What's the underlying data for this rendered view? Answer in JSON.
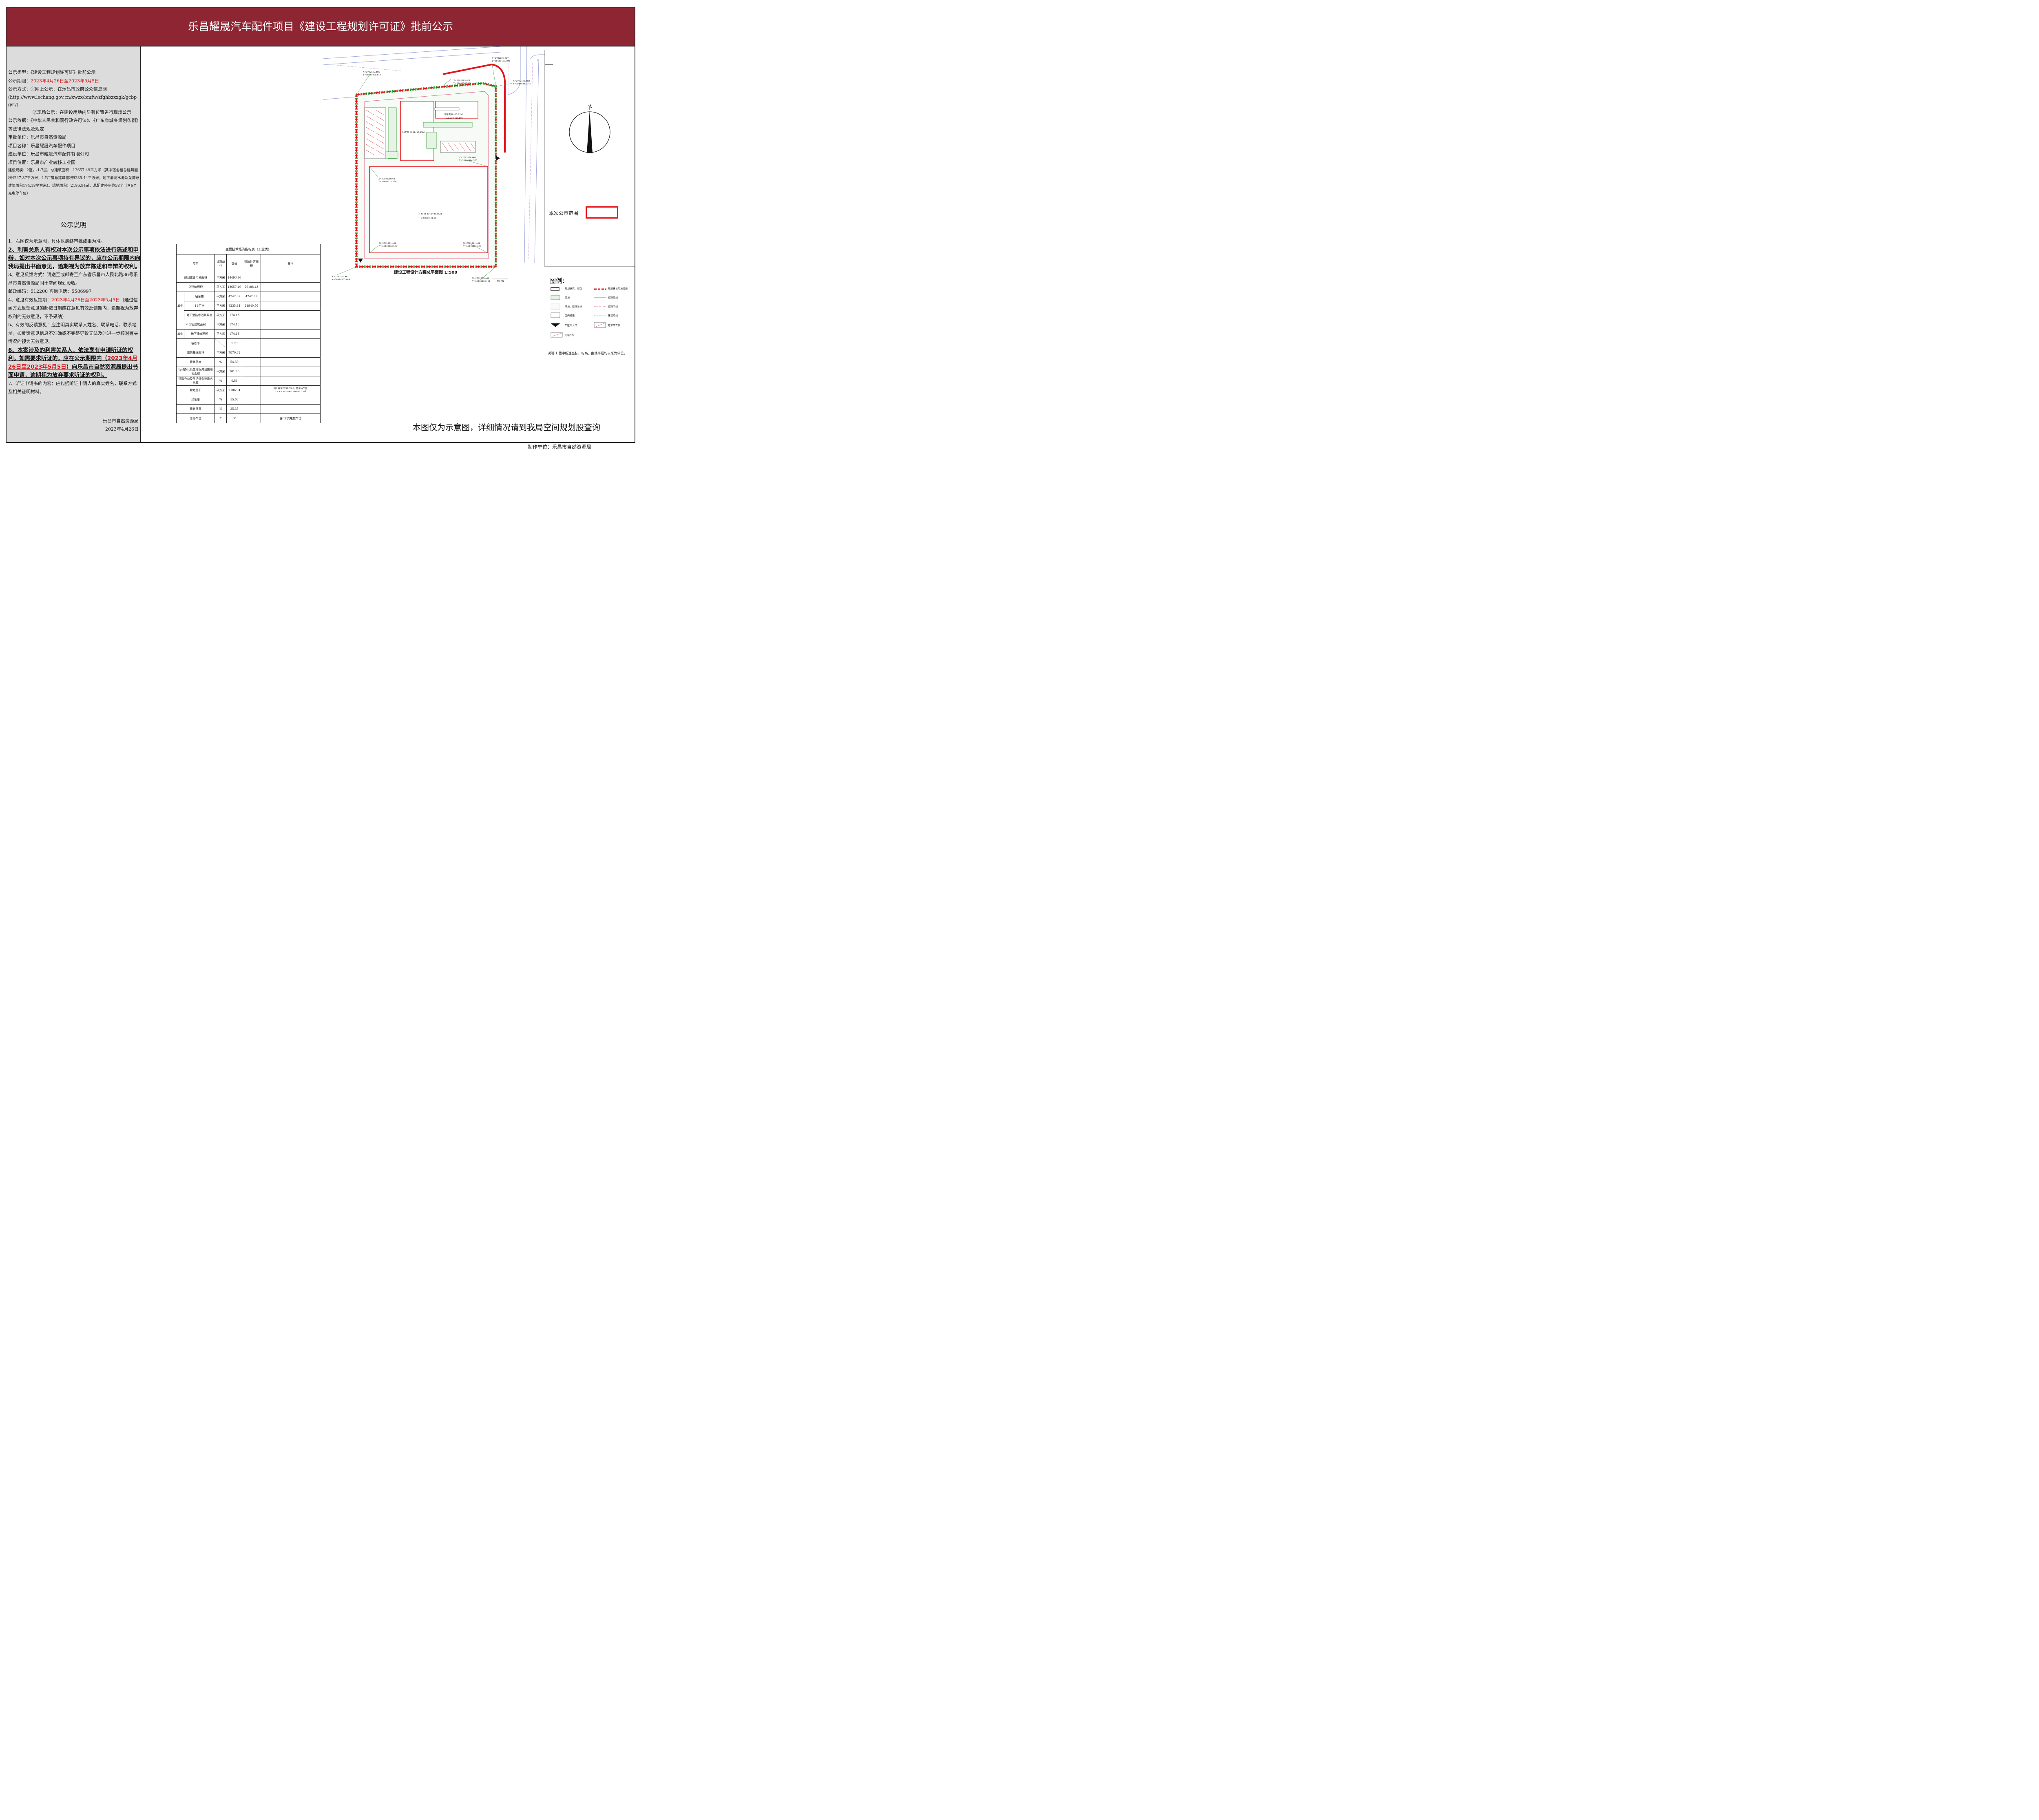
{
  "header": {
    "title": "乐昌耀晟汽车配件项目《建设工程规划许可证》批前公示"
  },
  "info": {
    "type": "公示类型：《建设工程规划许可证》批前公示",
    "period_label": "公示期限：",
    "period_value": "2023年4月26日至2023年5月5日",
    "method1": "公示方式：①网上公示：在乐昌市政府公众信息网",
    "method1_url": "(http://www.lechang.gov.cn/xwzx/bmfw/zfghbzxxgk/gcbpgst/)",
    "method2": "②现场公示：在建设用地内显著位置进行现场公示",
    "basis": "公示依据：《中华人民共和国行政许可法》、《广东省城乡规划条例》等法律法规及规定",
    "approver": "审批单位：乐昌市自然资源局",
    "project": "项目名称：乐昌耀晟汽车配件项目",
    "builder": "建设单位：乐昌市耀晟汽车配件有限公司",
    "location": "项目位置：乐昌市产业转移工业园",
    "scale": "建设规模：2座，-1-7层，总建筑面积：13657.49平方米（其中宿舍楼总建筑面积4247.87平方米；1#厂房总建筑面积9235.44平方米；地下消防水池及泵房总建筑面积174.18平方米）。绿地面积：2186.94㎡，总配建停车位58个（含6个充电停车位）"
  },
  "notes_title": "公示说明",
  "notes": {
    "n1": "1、右图仅为示意图，具体以最终审批成果为准。",
    "n2": "2、利害关系人有权对本次公示事项依法进行陈述和申辩，如对本次公示事项持有异议的，应在公示期限内向我局提出书面意见，逾期视为放弃陈述和申辩的权利。",
    "n3": "3、意见反馈方式：请送至或邮寄至广东省乐昌市人民北路36号乐昌市自然资源局国土空间规划股收。",
    "n3b": "邮政编码：512200 咨询电话：5586997",
    "n4_pre": "4、意见有效反馈期：",
    "n4_red": "2023年4月26日至2023年5月5日",
    "n4_post": "（通过信函方式反馈意见的邮戳日期应在意见有效反馈期内，逾期视为放弃权利的无效意见，不予采纳）",
    "n5": "5、有效的反馈意见：应注明真实联系人姓名、联系电话、联系地址，如反馈意见信息不准确或不完整导致无法及时进一步核对有关情况的视为无效意见。",
    "n6_pre": "6、本案涉及的利害关系人，依法享有申请听证的权利。如需要求听证的，应在公示期限内（",
    "n6_red": "2023年4月26日至2023年5月5日",
    "n6_post": "）向乐昌市自然资源局提出书面申请，逾期视为放弃要求听证的权利。",
    "n7": "7、听证申请书的内容：应包括听证申请人的真实姓名，联系方式及相关证明材料。"
  },
  "sign": {
    "org": "乐昌市自然资源局",
    "date": "2023年4月26日"
  },
  "table": {
    "title": "主要技术经济指标表（工业类）",
    "headers": [
      "项目",
      "计算单位",
      "数值",
      "建筑计容面积",
      "备注"
    ],
    "group1": "其中",
    "group2": "其中",
    "rows": [
      {
        "item": "规划建设用地面积",
        "unit": "平方米",
        "value": "14493.90",
        "far": "",
        "note": ""
      },
      {
        "item": "总建筑面积",
        "unit": "平方米",
        "value": "13657.49",
        "far": "26188.43",
        "note": ""
      },
      {
        "item": "宿舍楼",
        "unit": "平方米",
        "value": "4247.87",
        "far": "4247.87",
        "note": ""
      },
      {
        "item": "1#厂房",
        "unit": "平方米",
        "value": "9235.44",
        "far": "21940.56",
        "note": ""
      },
      {
        "item": "地下消防水池及泵房",
        "unit": "平方米",
        "value": "174.18",
        "far": "",
        "note": ""
      },
      {
        "item": "不计容建筑面积",
        "unit": "平方米",
        "value": "174.18",
        "far": "",
        "note": ""
      },
      {
        "item": "地下建筑面积",
        "unit": "平方米",
        "value": "174.18",
        "far": "",
        "note": ""
      },
      {
        "item": "容积率",
        "unit": "",
        "value": "1.79",
        "far": "",
        "note": ""
      },
      {
        "item": "建筑基底面积",
        "unit": "平方米",
        "value": "7870.83",
        "far": "",
        "note": ""
      },
      {
        "item": "建筑密度",
        "unit": "%",
        "value": "54.30",
        "far": "",
        "note": ""
      },
      {
        "item": "行政办公及生活服务设施用地面积",
        "unit": "平方米",
        "value": "701.68",
        "far": "",
        "note": ""
      },
      {
        "item": "行政办公及生活服务设施占地率",
        "unit": "%",
        "value": "4.84",
        "far": "",
        "note": ""
      },
      {
        "item": "绿地面积",
        "unit": "平方米",
        "value": "2186.94",
        "far": "",
        "note": "地上绿化2039.39㎡，植草砖车位2.4×5.3×58×0.2=147.55㎡"
      },
      {
        "item": "绿地率",
        "unit": "%",
        "value": "15.08",
        "far": "",
        "note": ""
      },
      {
        "item": "建筑限高",
        "unit": "米",
        "value": "25.35",
        "far": "",
        "note": ""
      },
      {
        "item": "总停车位",
        "unit": "个",
        "value": "58",
        "far": "",
        "note": "含6个充电桩车位"
      }
    ]
  },
  "plan": {
    "title": "建设工程设计方案总平面图 1:500",
    "north": "北",
    "scope_label": "本次公示范围",
    "factory_label": "1#厂房 1F  H=14.95M",
    "factory_elev": "±0.000[121.50]",
    "dorm_label": "1#厂房 L1 H=17.85M",
    "dorm_label2": "宿舍楼 H=25.35M",
    "dorm_elev": "±0.000[121.50]",
    "coords": {
      "c1": "X=2782682.495",
      "c1y": "Y=38440305.649",
      "c2": "X=2782683.861",
      "c2y": "Y=38440367.291",
      "c3": "X=2782693.627",
      "c3y": "Y=38440403.798",
      "c4": "X=2782685.183",
      "c4y": "Y=38440413.342",
      "c5": "X=2782628.961",
      "c5y": "Y=38440312.570",
      "c6": "X=2782628.961",
      "c6y": "Y=38440404.570",
      "c7": "X=2782561.461",
      "c7y": "Y=38440312.570",
      "c8": "X=2782561.461",
      "c8y": "Y=38440404.570",
      "c9": "X=2782553.461",
      "c9y": "Y=38440305.649",
      "c10": "X=2782553.461",
      "c10y": "Y=38440413.124"
    },
    "dim_25": "25.00",
    "dim_0": "0"
  },
  "legend": {
    "title": "图例:",
    "items": [
      "规划建筑、层数",
      "规划建设用地红线",
      "绿地",
      "道路红线",
      "场地、道路坐标",
      "道路中线",
      "区内道路",
      "建筑红线",
      "厂区出入口",
      "植草砖车位",
      "充电车位"
    ],
    "note": "说明:1.图中所注坐标、标高、曲线半径均以米为单位。"
  },
  "bottom_note": "本图仅为示意图，详细情况请到我局空间规划股查询",
  "maker": "制作单位：乐昌市自然资源局",
  "colors": {
    "header": "#8e2533",
    "panel": "#dcdcdc",
    "redline": "#e3141a",
    "green": "#2e9a2e"
  }
}
